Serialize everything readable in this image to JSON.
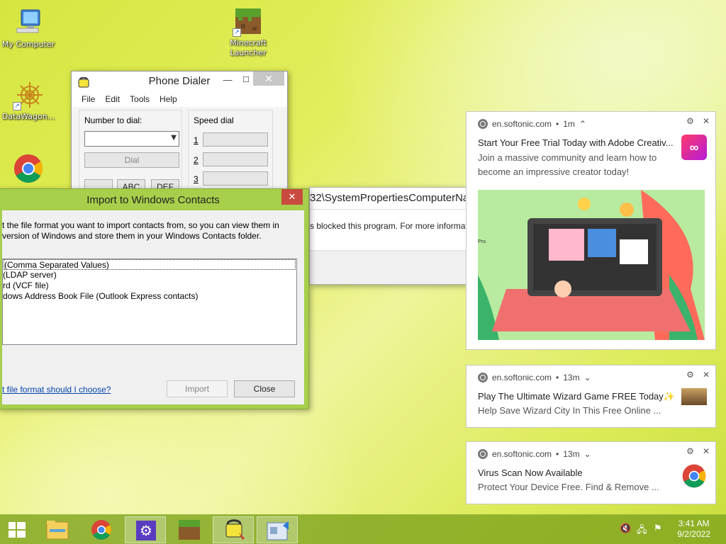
{
  "desktop": {
    "icons": [
      {
        "label": "My Computer"
      },
      {
        "label": "DataWagon..."
      },
      {
        "label": ""
      },
      {
        "label": "Minecraft Launcher"
      }
    ]
  },
  "phone_dialer": {
    "title": "Phone Dialer",
    "menu": [
      "File",
      "Edit",
      "Tools",
      "Help"
    ],
    "number_label": "Number to dial:",
    "speed_dial_label": "Speed dial",
    "dial_button": "Dial",
    "speed_numbers": [
      "1",
      "2",
      "3"
    ],
    "keypad": [
      "",
      "ABC",
      "DEF"
    ]
  },
  "blocked_window": {
    "path_text": "32\\SystemPropertiesComputerNa",
    "message": "s blocked this program. For more informat"
  },
  "import_dialog": {
    "title": "Import to Windows Contacts",
    "instruction_line1": "t the file format you want to import contacts from, so you can view them in",
    "instruction_line2": "version of Windows and store them in your Windows Contacts folder.",
    "formats": [
      " (Comma Separated Values)",
      " (LDAP server)",
      "rd (VCF file)",
      "dows Address Book File (Outlook Express contacts)"
    ],
    "help_link": "t file format should I choose?",
    "import_button": "Import",
    "close_button": "Close"
  },
  "notifications": [
    {
      "source": "en.softonic.com",
      "time": "1m",
      "title": "Start Your Free Trial Today with Adobe Creativ...",
      "body_line1": "Join a massive community and learn how to",
      "body_line2": "become an impressive creator today!",
      "image_caption": "Pro."
    },
    {
      "source": "en.softonic.com",
      "time": "13m",
      "title": "Play The Ultimate Wizard Game FREE Today✨",
      "body_line1": "Help Save Wizard City In This Free Online ..."
    },
    {
      "source": "en.softonic.com",
      "time": "13m",
      "title": "Virus Scan Now Available",
      "body_line1": "Protect Your Device Free. Find & Remove ..."
    }
  ],
  "taskbar": {
    "clock_time": "3:41 AM",
    "clock_date": "9/2/2022"
  },
  "colors": {
    "taskbar": "#80a51e",
    "dialog_frame": "#a7cf4b",
    "close_red": "#c94a3e",
    "link_blue": "#0645ad"
  }
}
